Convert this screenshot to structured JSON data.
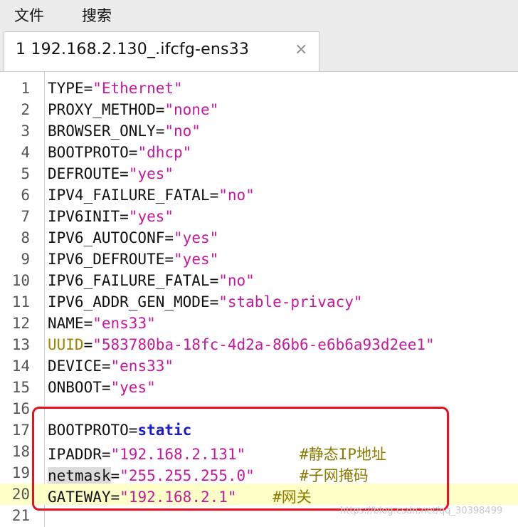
{
  "menubar": {
    "items": [
      "文件",
      "搜索"
    ]
  },
  "tab": {
    "index": "1",
    "title": "192.168.2.130_.ifcfg-ens33",
    "close_glyph": "×"
  },
  "lines": [
    {
      "n": "1",
      "key": "TYPE",
      "eq": "=",
      "val": "\"Ethernet\""
    },
    {
      "n": "2",
      "key": "PROXY_METHOD",
      "eq": "=",
      "val": "\"none\""
    },
    {
      "n": "3",
      "key": "BROWSER_ONLY",
      "eq": "=",
      "val": "\"no\""
    },
    {
      "n": "4",
      "key": "BOOTPROTO",
      "eq": "=",
      "val": "\"dhcp\""
    },
    {
      "n": "5",
      "key": "DEFROUTE",
      "eq": "=",
      "val": "\"yes\""
    },
    {
      "n": "6",
      "key": "IPV4_FAILURE_FATAL",
      "eq": "=",
      "val": "\"no\""
    },
    {
      "n": "7",
      "key": "IPV6INIT",
      "eq": "=",
      "val": "\"yes\""
    },
    {
      "n": "8",
      "key": "IPV6_AUTOCONF",
      "eq": "=",
      "val": "\"yes\""
    },
    {
      "n": "9",
      "key": "IPV6_DEFROUTE",
      "eq": "=",
      "val": "\"yes\""
    },
    {
      "n": "10",
      "key": "IPV6_FAILURE_FATAL",
      "eq": "=",
      "val": "\"no\""
    },
    {
      "n": "11",
      "key": "IPV6_ADDR_GEN_MODE",
      "eq": "=",
      "val": "\"stable-privacy\""
    },
    {
      "n": "12",
      "key": "NAME",
      "eq": "=",
      "val": "\"ens33\""
    },
    {
      "n": "13",
      "key": "UUID",
      "eq": "=",
      "val": "\"583780ba-18fc-4d2a-86b6-e6b6a93d2ee1\""
    },
    {
      "n": "14",
      "key": "DEVICE",
      "eq": "=",
      "val": "\"ens33\""
    },
    {
      "n": "15",
      "key": "ONBOOT",
      "eq": "=",
      "val": "\"yes\""
    },
    {
      "n": "16",
      "key": "",
      "eq": "",
      "val": ""
    },
    {
      "n": "17",
      "key": "BOOTPROTO",
      "eq": "=",
      "val": "static"
    },
    {
      "n": "18",
      "key": "IPADDR",
      "eq": "=",
      "val": "\"192.168.2.131\"",
      "pad": "      ",
      "comment": "#静态IP地址"
    },
    {
      "n": "19",
      "key": "netmask",
      "eq": "=",
      "val": "\"255.255.255.0\"",
      "pad": "     ",
      "comment": "#子网掩码"
    },
    {
      "n": "20",
      "key": "GATEWAY",
      "eq": "=",
      "val": "\"192.168.2.1\"",
      "pad": "    ",
      "comment": "#网关"
    },
    {
      "n": "21",
      "key": "",
      "eq": "",
      "val": ""
    }
  ],
  "watermark": "https://blog.csdn.net/qq_30398499",
  "colors": {
    "string": "#c7179e",
    "keyword": "#1c1cc8",
    "comment": "#8a7a00",
    "current_line": "#ffffc8",
    "highlight_box": "#e8101c"
  }
}
